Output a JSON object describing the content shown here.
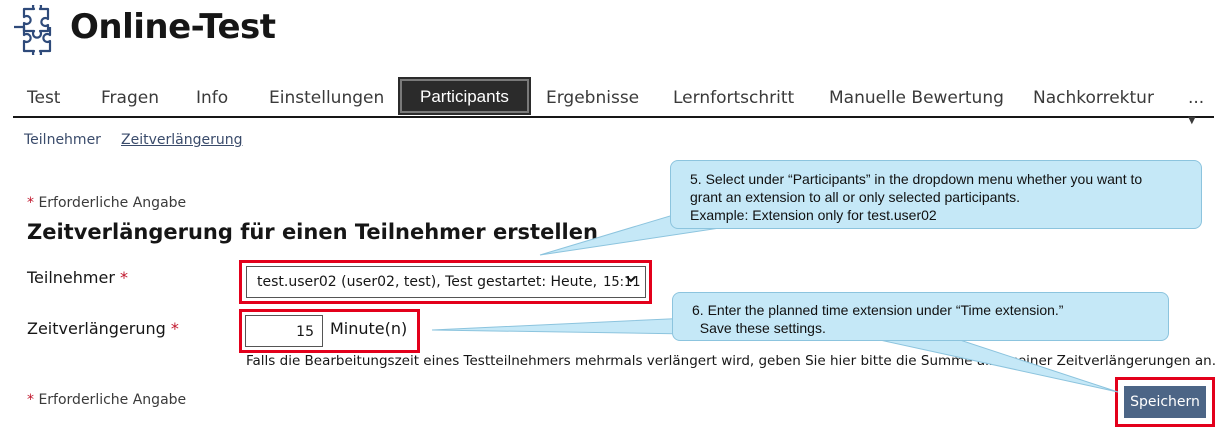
{
  "header": {
    "title": "Online-Test",
    "icon": "puzzle-icon"
  },
  "tabs": [
    {
      "label": "Test"
    },
    {
      "label": "Fragen"
    },
    {
      "label": "Info"
    },
    {
      "label": "Einstellungen"
    },
    {
      "label": "Participants",
      "active": true
    },
    {
      "label": "Ergebnisse"
    },
    {
      "label": "Lernfortschritt"
    },
    {
      "label": "Manuelle Bewertung"
    },
    {
      "label": "Nachkorrektur"
    }
  ],
  "more_label": "...",
  "subtabs": [
    {
      "label": "Teilnehmer"
    },
    {
      "label": "Zeitverlängerung",
      "active": true
    }
  ],
  "form": {
    "required_note": "Erforderliche Angabe",
    "required_star": "*",
    "heading": "Zeitverlängerung für einen Teilnehmer erstellen",
    "participant_label": "Teilnehmer",
    "participant_value": "test.user02 (user02, test), Test gestartet: Heute,",
    "participant_time": "15:11",
    "extension_label": "Zeitverlängerung",
    "extension_value": "15",
    "extension_unit": "Minute(n)",
    "help_text": "Falls die Bearbeitungszeit eines Testteilnehmers mehrmals verlängert wird, geben Sie hier bitte die Summe aller seiner Zeitverlängerungen an.",
    "save_label": "Speichern"
  },
  "callouts": {
    "step5": [
      "5. Select under “Participants” in the dropdown menu whether you want to",
      "grant an extension to all or only selected participants.",
      "Example: Extension only for test.user02"
    ],
    "step6": [
      "6. Enter the planned time extension under “Time extension.”",
      "  Save these settings."
    ]
  },
  "colors": {
    "accent_red": "#e3001b",
    "button": "#4c6586",
    "callout_bg": "#c5e8f7",
    "active_tab": "#2b2b2b"
  }
}
